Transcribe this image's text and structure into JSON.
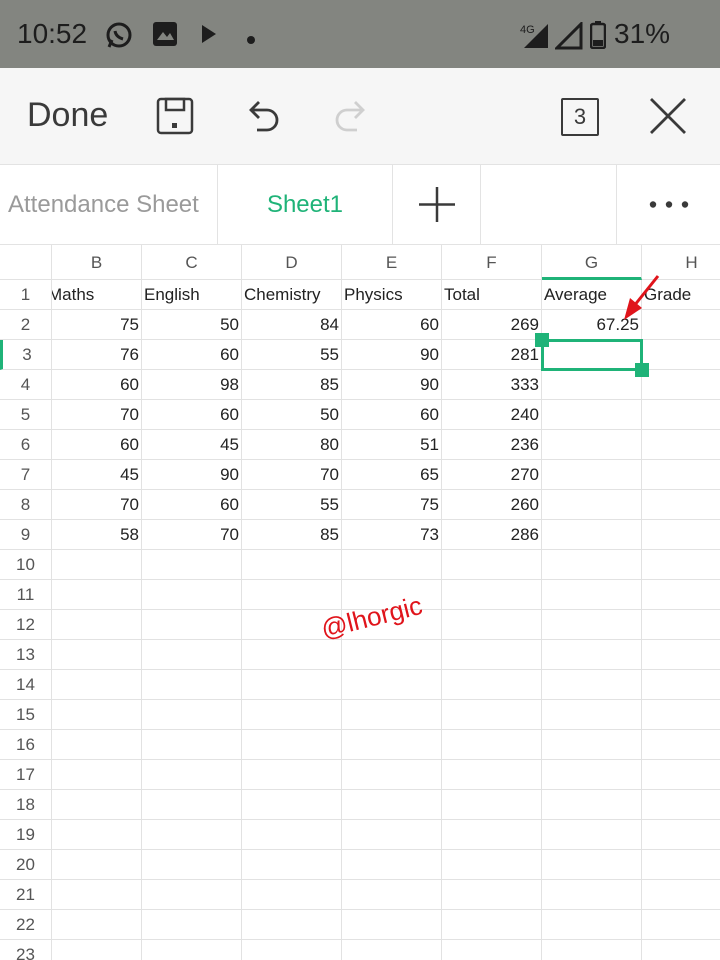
{
  "status_bar": {
    "time": "10:52",
    "network": "4G",
    "battery": "31%",
    "icons": [
      "whatsapp-icon",
      "gallery-icon",
      "play-store-icon",
      "dot-icon",
      "signal-icon",
      "battery-icon"
    ]
  },
  "toolbar": {
    "done_label": "Done",
    "sheet_count": "3",
    "icons": [
      "save-icon",
      "undo-icon",
      "redo-icon",
      "close-icon"
    ]
  },
  "tabs": [
    {
      "label": "Attendance Sheet",
      "active": false
    },
    {
      "label": "Sheet1",
      "active": true
    }
  ],
  "colors": {
    "accent": "#1fb378",
    "annotation": "#e0141b"
  },
  "grid": {
    "columns": [
      "B",
      "C",
      "D",
      "E",
      "F",
      "G",
      "H"
    ],
    "active_column": "G",
    "active_row": "3",
    "rows": [
      {
        "num": "1",
        "cells": [
          "Maths",
          "English",
          "Chemistry",
          "Physics",
          "Total",
          "Average",
          "Grade"
        ]
      },
      {
        "num": "2",
        "cells": [
          "75",
          "50",
          "84",
          "60",
          "269",
          "67.25",
          ""
        ]
      },
      {
        "num": "3",
        "cells": [
          "76",
          "60",
          "55",
          "90",
          "281",
          "",
          ""
        ]
      },
      {
        "num": "4",
        "cells": [
          "60",
          "98",
          "85",
          "90",
          "333",
          "",
          ""
        ]
      },
      {
        "num": "5",
        "cells": [
          "70",
          "60",
          "50",
          "60",
          "240",
          "",
          ""
        ]
      },
      {
        "num": "6",
        "cells": [
          "60",
          "45",
          "80",
          "51",
          "236",
          "",
          ""
        ]
      },
      {
        "num": "7",
        "cells": [
          "45",
          "90",
          "70",
          "65",
          "270",
          "",
          ""
        ]
      },
      {
        "num": "8",
        "cells": [
          "70",
          "60",
          "55",
          "75",
          "260",
          "",
          ""
        ]
      },
      {
        "num": "9",
        "cells": [
          "58",
          "70",
          "85",
          "73",
          "286",
          "",
          ""
        ]
      },
      {
        "num": "10",
        "cells": [
          "",
          "",
          "",
          "",
          "",
          "",
          ""
        ]
      },
      {
        "num": "11",
        "cells": [
          "",
          "",
          "",
          "",
          "",
          "",
          ""
        ]
      },
      {
        "num": "12",
        "cells": [
          "",
          "",
          "",
          "",
          "",
          "",
          ""
        ]
      },
      {
        "num": "13",
        "cells": [
          "",
          "",
          "",
          "",
          "",
          "",
          ""
        ]
      },
      {
        "num": "14",
        "cells": [
          "",
          "",
          "",
          "",
          "",
          "",
          ""
        ]
      },
      {
        "num": "15",
        "cells": [
          "",
          "",
          "",
          "",
          "",
          "",
          ""
        ]
      },
      {
        "num": "16",
        "cells": [
          "",
          "",
          "",
          "",
          "",
          "",
          ""
        ]
      },
      {
        "num": "17",
        "cells": [
          "",
          "",
          "",
          "",
          "",
          "",
          ""
        ]
      },
      {
        "num": "18",
        "cells": [
          "",
          "",
          "",
          "",
          "",
          "",
          ""
        ]
      },
      {
        "num": "19",
        "cells": [
          "",
          "",
          "",
          "",
          "",
          "",
          ""
        ]
      },
      {
        "num": "20",
        "cells": [
          "",
          "",
          "",
          "",
          "",
          "",
          ""
        ]
      },
      {
        "num": "21",
        "cells": [
          "",
          "",
          "",
          "",
          "",
          "",
          ""
        ]
      },
      {
        "num": "22",
        "cells": [
          "",
          "",
          "",
          "",
          "",
          "",
          ""
        ]
      },
      {
        "num": "23",
        "cells": [
          "",
          "",
          "",
          "",
          "",
          "",
          ""
        ]
      }
    ]
  },
  "watermark": "@lhorgic"
}
